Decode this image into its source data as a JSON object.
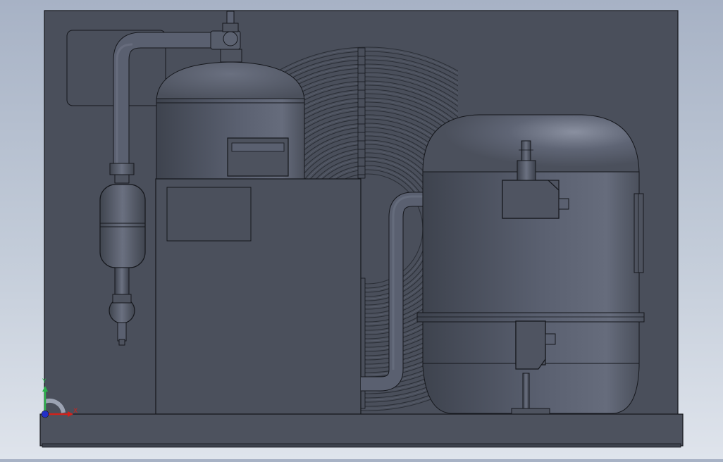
{
  "viewport": {
    "background_top": "#a7b2c5",
    "background_bottom": "#dfe4ec",
    "model_fill": "#4a4f5b",
    "edge_color": "#15171c"
  },
  "triad": {
    "x_label": "X",
    "y_label": "Y",
    "x_color": "#d0221b",
    "y_color": "#2bb24c",
    "z_color": "#2330c8"
  }
}
